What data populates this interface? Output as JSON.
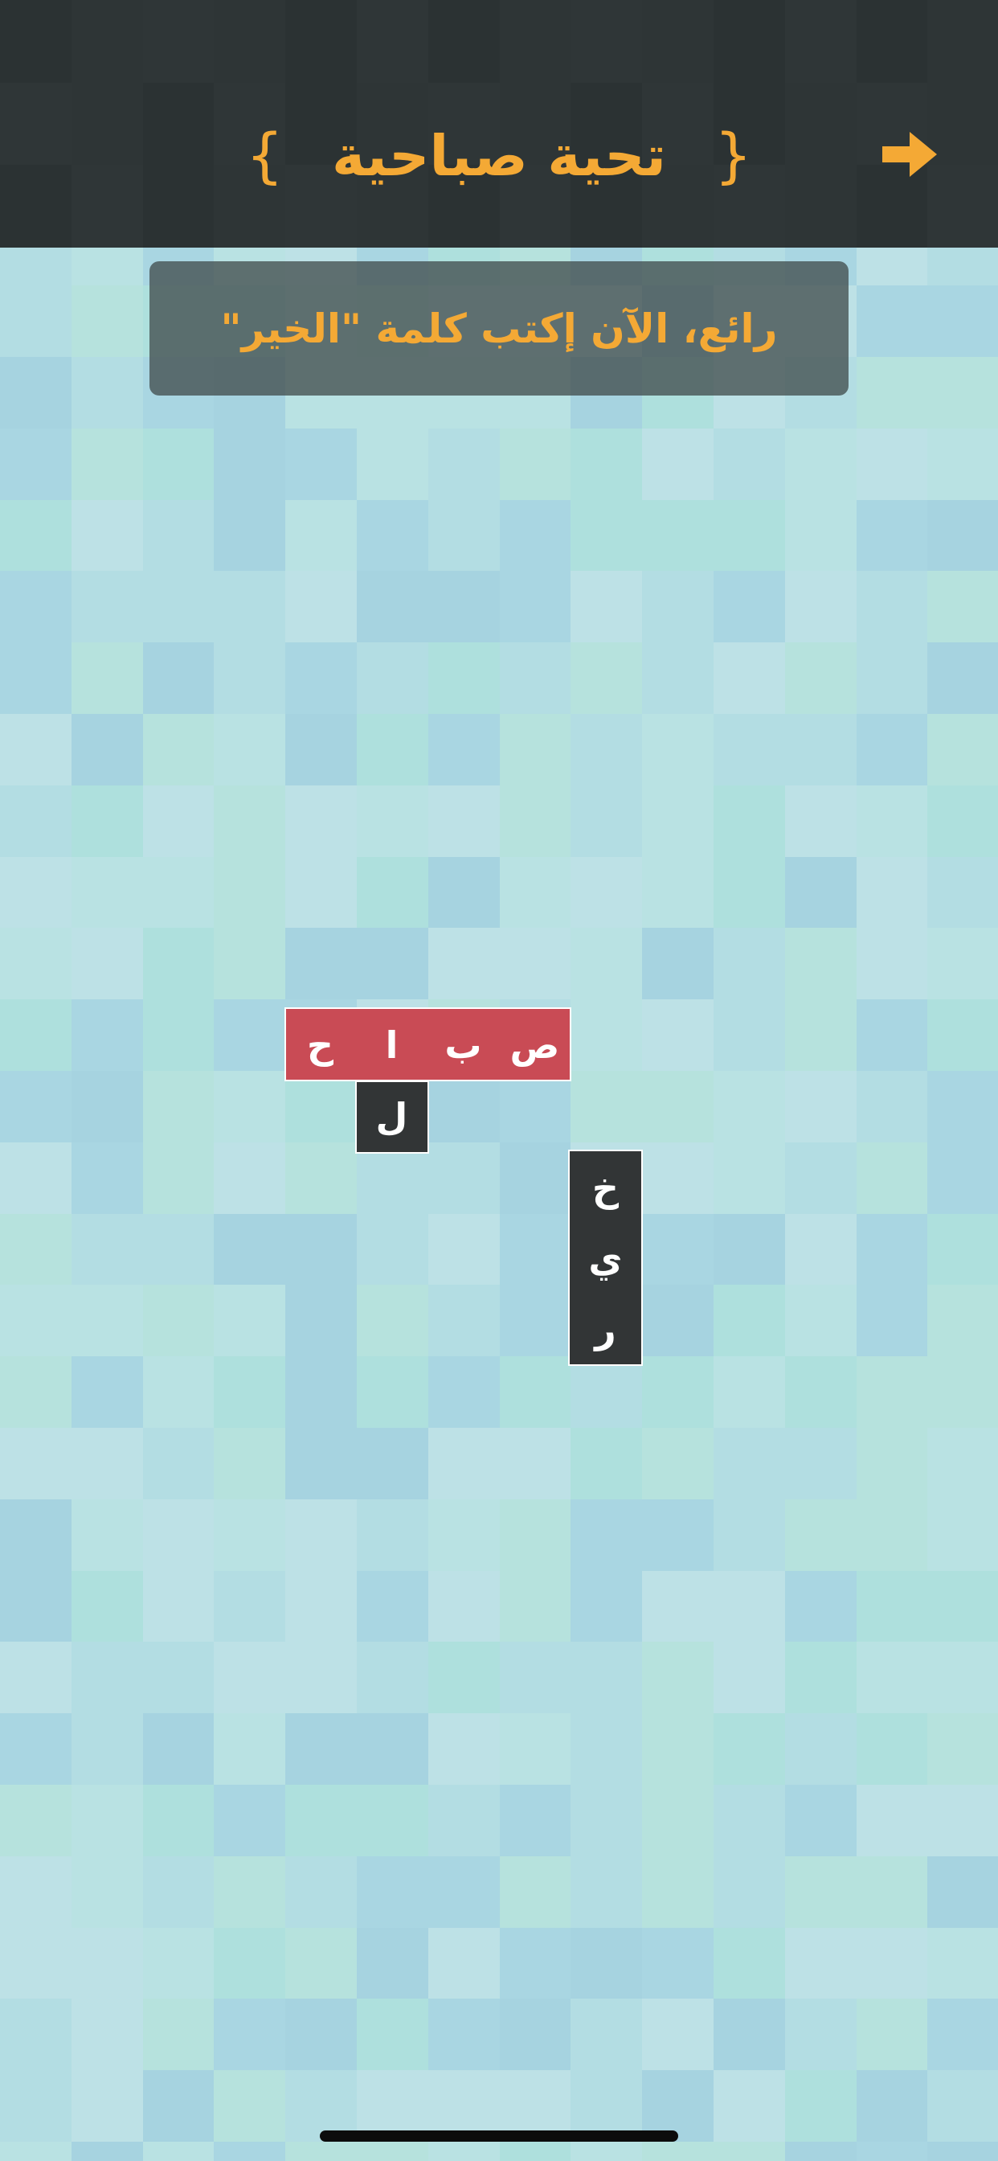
{
  "header": {
    "title": "تحية صباحية",
    "brace_left": "{",
    "brace_right": "}",
    "back_icon": "arrow-right-icon"
  },
  "hint": {
    "text": "رائع، الآن إكتب كلمة \"الخير\""
  },
  "board": {
    "word_sabah": {
      "state": "solved",
      "color": "#c94b55",
      "letters": [
        "ص",
        "ب",
        "ا",
        "ح"
      ]
    },
    "tile_lam": {
      "letter": "ل"
    },
    "word_khayr": {
      "state": "pending",
      "color": "#323536",
      "letters": [
        "خ",
        "ي",
        "ر"
      ]
    }
  },
  "colors": {
    "header_bg": "#2e3536",
    "accent": "#f4a935",
    "hint_bg": "#4b5656",
    "background": "#b3dde3"
  }
}
